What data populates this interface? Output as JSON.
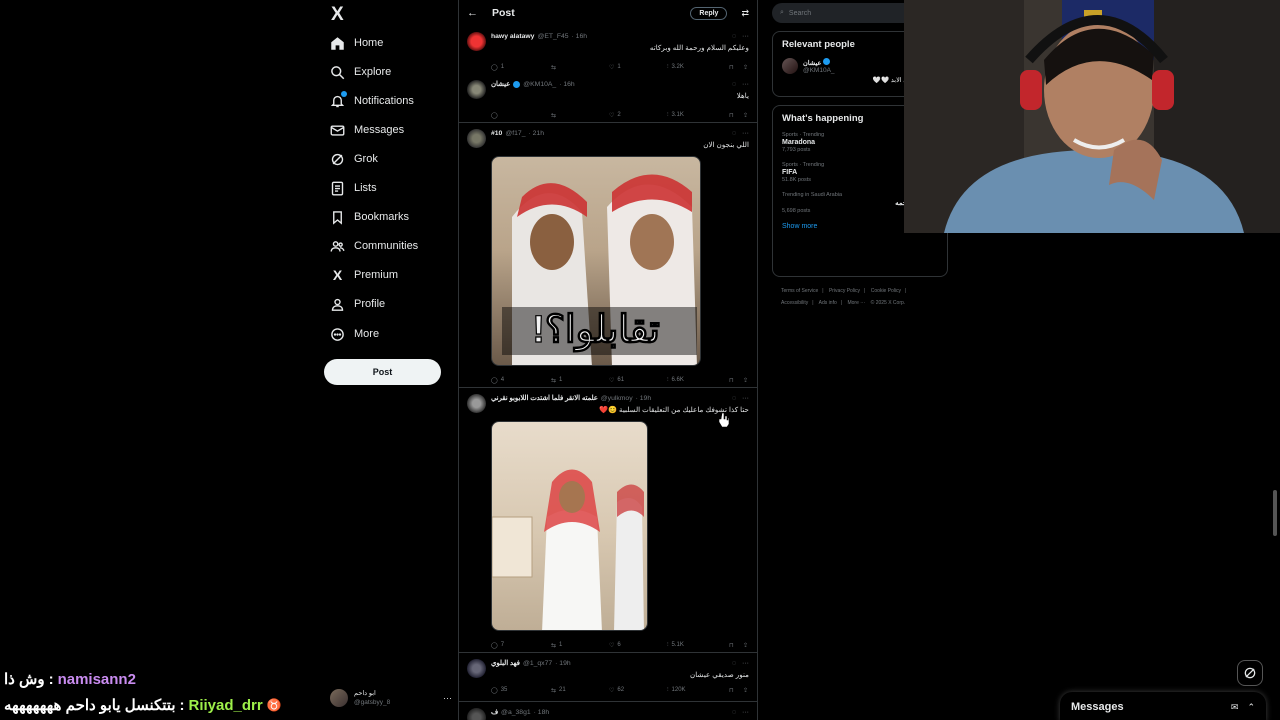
{
  "nav": {
    "logo": "X",
    "items": [
      {
        "label": "Home",
        "icon": "home-icon"
      },
      {
        "label": "Explore",
        "icon": "search-icon"
      },
      {
        "label": "Notifications",
        "icon": "bell-icon"
      },
      {
        "label": "Messages",
        "icon": "mail-icon"
      },
      {
        "label": "Grok",
        "icon": "grok-icon"
      },
      {
        "label": "Lists",
        "icon": "list-icon"
      },
      {
        "label": "Bookmarks",
        "icon": "bookmark-icon"
      },
      {
        "label": "Communities",
        "icon": "people-icon"
      },
      {
        "label": "Premium",
        "icon": "x-icon"
      },
      {
        "label": "Profile",
        "icon": "person-icon"
      },
      {
        "label": "More",
        "icon": "more-circle-icon"
      }
    ],
    "post_label": "Post",
    "account": {
      "name": "ابو داحم",
      "handle": "@gatsbyy_8"
    }
  },
  "main": {
    "title": "Post",
    "reply_label": "Reply",
    "tweets": [
      {
        "name": "hawy alatawy",
        "handle": "@ET_F45",
        "time": "· 16h",
        "text": "وعليكم السلام ورحمة الله وبركاته",
        "replies": "1",
        "retweets": "",
        "likes": "1",
        "views": "3.2K",
        "verified": false
      },
      {
        "name": "عيشان",
        "handle": "@KM10A_",
        "time": "· 16h",
        "text": "ياهلا",
        "replies": "",
        "retweets": "",
        "likes": "2",
        "views": "3.1K",
        "verified": true
      },
      {
        "name": "#10",
        "handle": "@f17_",
        "time": "· 21h",
        "text": "اللي بنجون الان",
        "replies": "4",
        "retweets": "1",
        "likes": "61",
        "views": "6.6K",
        "verified": false,
        "media_caption": "تقابلوا؟!"
      },
      {
        "name": "علمته الانقر فلما اشتدت اللابوبو نقرني",
        "handle": "@yulkmoy",
        "time": "· 19h",
        "text": "حتا كذا تشوفك ماعليك من التعليقات السلبية 😊❤️",
        "replies": "7",
        "retweets": "1",
        "likes": "6",
        "views": "5.1K",
        "verified": false
      },
      {
        "name": "فهد البلوي",
        "handle": "@1_qx77",
        "time": "· 19h",
        "text": "منور صديقي عيشان",
        "replies": "35",
        "retweets": "21",
        "likes": "62",
        "views": "120K",
        "verified": false
      },
      {
        "name": "ف",
        "handle": "@a_38g1",
        "time": "· 18h",
        "text": "",
        "replies": "",
        "retweets": "",
        "likes": "",
        "views": "",
        "verified": false
      }
    ]
  },
  "side": {
    "search_placeholder": "Search",
    "relevant_title": "Relevant people",
    "relevant": {
      "name": "عيشان",
      "handle": "@KM10A_",
      "bio": "ال مدريد الى الابد 🤍🤍"
    },
    "happening_title": "What's happening",
    "trends": [
      {
        "category": "Sports · Trending",
        "title": "Maradona",
        "count": "7,793 posts"
      },
      {
        "category": "Sports · Trending",
        "title": "FIFA",
        "count": "51.8K posts"
      },
      {
        "category": "Trending in Saudi Arabia",
        "title": "#الهلال_النجمه",
        "count": "5,698 posts"
      }
    ],
    "show_more": "Show more",
    "footer": [
      "Terms of Service",
      "|",
      "Privacy Policy",
      "|",
      "Cookie Policy",
      "|",
      "Accessibility",
      "|",
      "Ads info",
      "|",
      "More ···",
      "© 2025 X Corp."
    ]
  },
  "messages_drawer": {
    "label": "Messages"
  },
  "chat": [
    {
      "user": "namisann2",
      "message": "وش ذا",
      "color": "#c98cf0"
    },
    {
      "user": "Riiyad_drr",
      "message": "بتتكنسل يابو داحم هههههههه",
      "color": "#9ef04a"
    }
  ],
  "colors": {
    "accent": "#1d9bf0",
    "bg": "#000000",
    "border": "#2f3336",
    "muted": "#71767b"
  }
}
